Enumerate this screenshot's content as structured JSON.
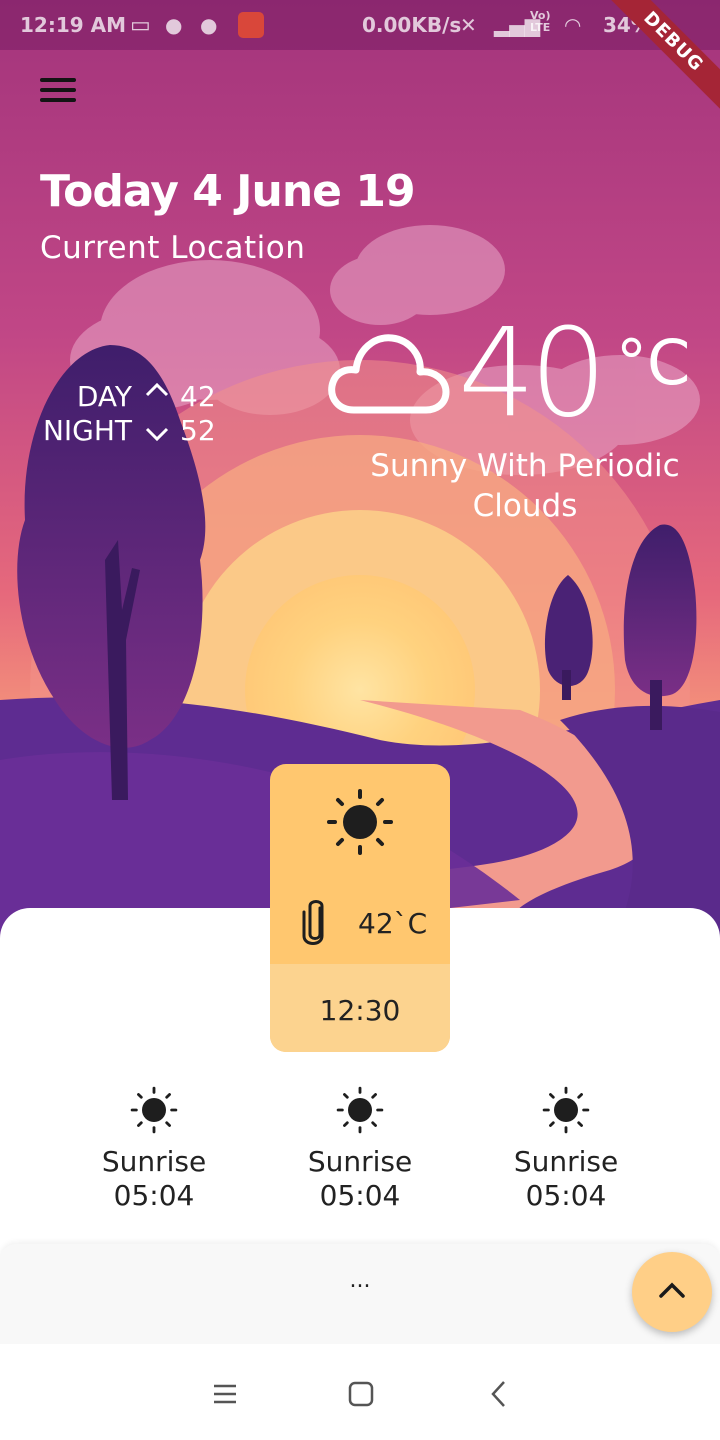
{
  "status_bar": {
    "time": "12:19 AM",
    "network_speed": "0.00KB/s",
    "battery": "34%",
    "volte": "Vo) LTE"
  },
  "debug_banner": "DEBUG",
  "header": {
    "date": "Today 4 June 19",
    "location": "Current Location"
  },
  "day_night": {
    "day_label": "DAY",
    "day_value": "42",
    "night_label": "NIGHT",
    "night_value": "52"
  },
  "current": {
    "temperature": "40",
    "unit": "°C",
    "condition": "Sunny With Periodic Clouds",
    "icon": "cloud-icon"
  },
  "hourly_card": {
    "icon": "sun-icon",
    "clip_icon": "paperclip-icon",
    "temperature": "42`C",
    "time": "12:30"
  },
  "sun_slots": [
    {
      "label": "Sunrise",
      "time": "05:04",
      "icon": "sun-icon"
    },
    {
      "label": "Sunrise",
      "time": "05:04",
      "icon": "sun-icon"
    },
    {
      "label": "Sunrise",
      "time": "05:04",
      "icon": "sun-icon"
    }
  ],
  "panel": {
    "dots": "..."
  },
  "colors": {
    "accent": "#ffc76f",
    "accent_light": "#fcd38f",
    "sky_top": "#a3347c",
    "sky_mid": "#e0607a",
    "hill": "#5b2a8f",
    "tree": "#4b1f6f",
    "sun_core": "#ffd37f"
  }
}
